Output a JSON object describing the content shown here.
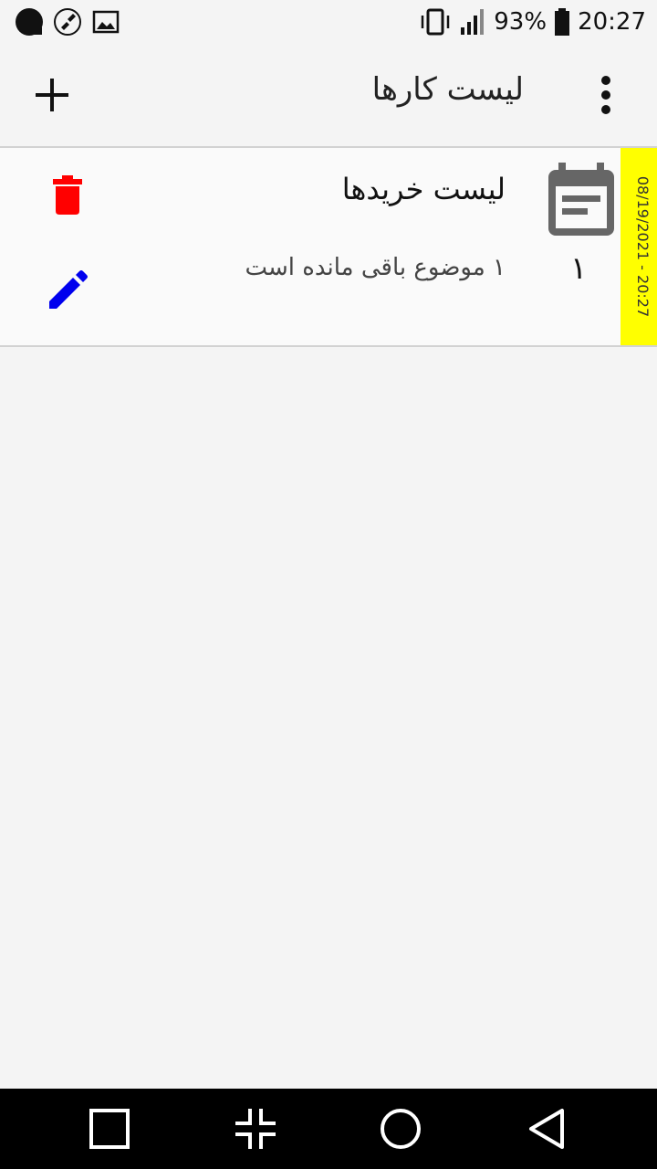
{
  "status_bar": {
    "left_icons": [
      "circle-icon",
      "brush-icon",
      "image-icon"
    ],
    "battery_percent": "93%",
    "time": "20:27",
    "icons": [
      "vibrate-icon",
      "signal-icon",
      "battery-icon"
    ]
  },
  "app_bar": {
    "title": "لیست کارها",
    "add_icon": "plus-icon",
    "menu_icon": "more-vert-icon"
  },
  "list": {
    "items": [
      {
        "title": "لیست خریدها",
        "subtitle": "۱ موضوع باقی مانده است",
        "count": "۱",
        "date": "08/19/2021 - 20:27",
        "icon": "calendar-icon",
        "actions": [
          "delete-icon",
          "edit-icon"
        ]
      }
    ]
  },
  "colors": {
    "date_strip": "#ffff00",
    "delete": "#ff0000",
    "edit": "#0000ee",
    "calendar": "#666666",
    "nav_bar": "#000000"
  },
  "nav_bar": {
    "buttons": [
      "recents-icon",
      "collapse-icon",
      "home-icon",
      "back-icon"
    ]
  }
}
